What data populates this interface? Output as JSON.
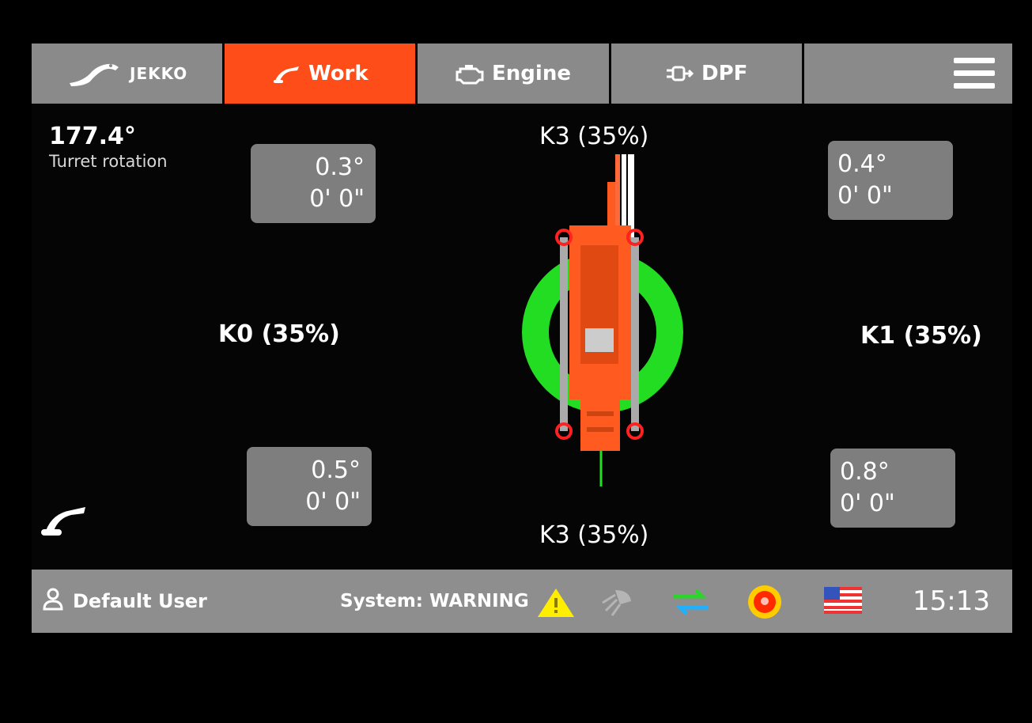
{
  "tabs": {
    "logo": "JEKKO",
    "work": "Work",
    "engine": "Engine",
    "dpf": "DPF"
  },
  "turret": {
    "value": "177.4°",
    "label": "Turret rotation"
  },
  "corners": {
    "front_left": {
      "angle": "0.3°",
      "distance": "0' 0\""
    },
    "front_right": {
      "angle": "0.4°",
      "distance": "0' 0\""
    },
    "rear_left": {
      "angle": "0.5°",
      "distance": "0' 0\""
    },
    "rear_right": {
      "angle": "0.8°",
      "distance": "0' 0\""
    }
  },
  "outriggers": {
    "top": "K3 (35%)",
    "left": "K0 (35%)",
    "right": "K1 (35%)",
    "bottom": "K3 (35%)"
  },
  "status": {
    "user": "Default User",
    "system": "System: WARNING",
    "time": "15:13"
  },
  "colors": {
    "accent": "#ff4d1a",
    "ring": "#22dd22",
    "warning": "#ffee00",
    "estop": "#ff6a00"
  },
  "icons": [
    "crane-icon",
    "engine-icon",
    "dpf-icon",
    "menu-icon",
    "user-icon",
    "warning-icon",
    "work-light-icon",
    "data-transfer-icon",
    "emergency-stop-icon",
    "us-flag-icon",
    "crane-mode-icon"
  ]
}
